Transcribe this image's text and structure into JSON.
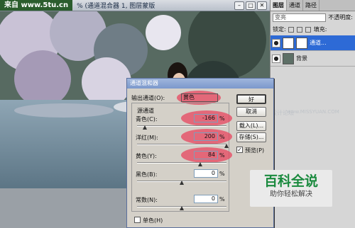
{
  "colors": {
    "accent": "#2d6ad6",
    "highlight": "#e8465f",
    "watermark": "#2b5d2d"
  },
  "window": {
    "watermark": "来自 www.5tu.cn",
    "title": "% (通道混合器 1, 图层蒙版",
    "minimize_icon": "minimize-icon",
    "maximize_icon": "maximize-icon",
    "close_icon": "close-icon"
  },
  "layers_panel": {
    "tabs": [
      "图层",
      "通道",
      "路径"
    ],
    "blend_mode": "变亮",
    "opacity_label": "不透明度:",
    "lock_label": "锁定:",
    "fill_label": "填充:",
    "layers": [
      {
        "name": "通道..."
      },
      {
        "name": "背景"
      }
    ]
  },
  "dialog": {
    "title": "通道混和器",
    "output_label": "输出通道(O):",
    "output_value": "黄色",
    "group_label": "源通道",
    "channels": [
      {
        "label": "青色(C):",
        "value": "-166",
        "unit": "%",
        "level": -166
      },
      {
        "label": "洋红(M):",
        "value": "200",
        "unit": "%",
        "level": 200
      },
      {
        "label": "黄色(Y):",
        "value": "84",
        "unit": "%",
        "level": 84
      },
      {
        "label": "黑色(B):",
        "value": "0",
        "unit": "%",
        "level": 0
      }
    ],
    "constant": {
      "label": "常数(N):",
      "value": "0",
      "unit": "%",
      "level": 0
    },
    "buttons": {
      "ok": "好",
      "cancel": "取消",
      "load": "载入(L)...",
      "save": "存储(S)..."
    },
    "preview_label": "预览(P)",
    "mono_label": "单色(H)"
  },
  "watermark_text": {
    "forum": "思缘设计论坛",
    "site": "www.MISSYUAN.COM"
  },
  "logo": {
    "title": "百科全说",
    "subtitle": "助你轻松解决"
  }
}
